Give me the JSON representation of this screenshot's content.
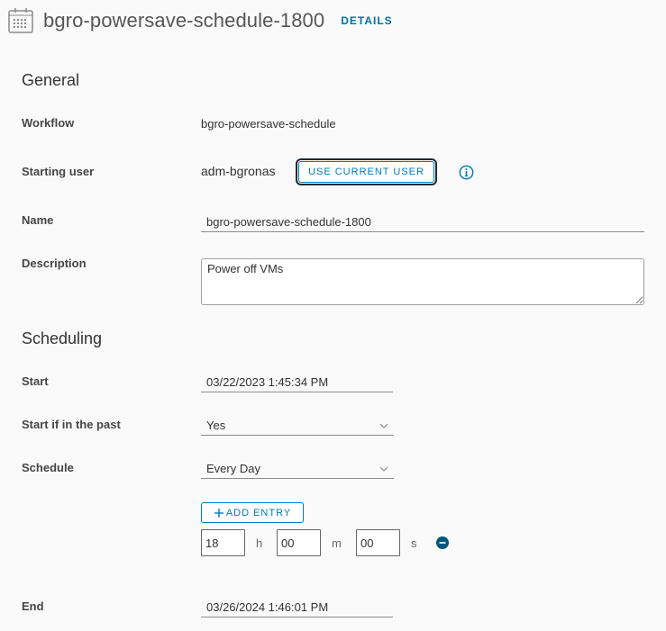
{
  "header": {
    "icon": "calendar-icon",
    "title": "bgro-powersave-schedule-1800",
    "details_link": "DETAILS"
  },
  "general": {
    "heading": "General",
    "workflow_label": "Workflow",
    "workflow_value": "bgro-powersave-schedule",
    "starting_user_label": "Starting user",
    "starting_user_value": "adm-bgronas",
    "use_current_user_button": "USE CURRENT USER",
    "info_icon": "info-icon",
    "name_label": "Name",
    "name_value": "bgro-powersave-schedule-1800",
    "description_label": "Description",
    "description_value": "Power off VMs"
  },
  "scheduling": {
    "heading": "Scheduling",
    "start_label": "Start",
    "start_value": "03/22/2023 1:45:34 PM",
    "start_if_past_label": "Start if in the past",
    "start_if_past_value": "Yes",
    "schedule_label": "Schedule",
    "schedule_value": "Every Day",
    "add_entry_button": "ADD ENTRY",
    "entry": {
      "hours": "18",
      "hours_unit": "h",
      "minutes": "00",
      "minutes_unit": "m",
      "seconds": "00",
      "seconds_unit": "s",
      "remove_icon": "minus-circle-icon"
    },
    "end_label": "End",
    "end_value": "03/26/2024 1:46:01 PM"
  },
  "colors": {
    "accent": "#0079b8",
    "link": "#0072a3",
    "remove_icon": "#00567a"
  }
}
